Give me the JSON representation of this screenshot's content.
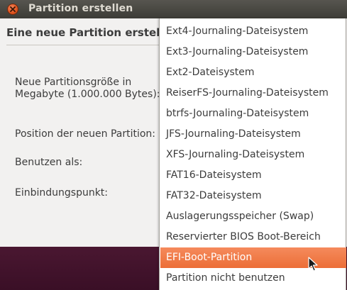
{
  "window": {
    "title": "Partition erstellen"
  },
  "dialog": {
    "heading": "Eine neue Partition erstell",
    "labels": {
      "size_line1": "Neue Partitionsgröße in",
      "size_line2": "Megabyte (1.000.000 Bytes):",
      "position": "Position der neuen Partition:",
      "use_as": "Benutzen als:",
      "mount_point": "Einbindungspunkt:"
    }
  },
  "dropdown": {
    "selected_index": 11,
    "items": [
      {
        "label": "Ext4-Journaling-Dateisystem"
      },
      {
        "label": "Ext3-Journaling-Dateisystem"
      },
      {
        "label": "Ext2-Dateisystem"
      },
      {
        "label": "ReiserFS-Journaling-Dateisystem"
      },
      {
        "label": "btrfs-Journaling-Dateisystem"
      },
      {
        "label": "JFS-Journaling-Dateisystem"
      },
      {
        "label": "XFS-Journaling-Dateisystem"
      },
      {
        "label": "FAT16-Dateisystem"
      },
      {
        "label": "FAT32-Dateisystem"
      },
      {
        "label": "Auslagerungsspeicher (Swap)"
      },
      {
        "label": "Reservierter BIOS Boot-Bereich"
      },
      {
        "label": "EFI-Boot-Partition"
      },
      {
        "label": "Partition nicht benutzen"
      }
    ]
  },
  "colors": {
    "accent": "#ec6e37",
    "titlebar": "#3d3c37",
    "close_button": "#e0531e"
  },
  "icons": {
    "close": "close-icon",
    "cursor": "mouse-pointer-icon"
  }
}
